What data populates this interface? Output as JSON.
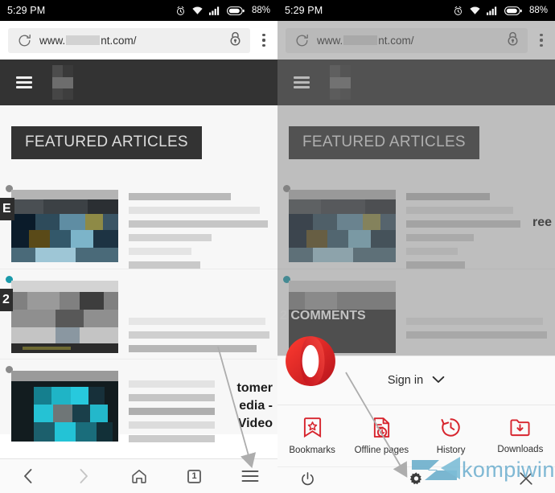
{
  "status_bar": {
    "time": "5:29 PM",
    "battery_percent": "88%",
    "icons": [
      "alarm-icon",
      "wifi-icon",
      "signal-icon",
      "battery-icon"
    ]
  },
  "browser": {
    "url_prefix": "www.",
    "url_suffix": "nt.com/",
    "reload_icon": "reload-icon",
    "lock_icon": "lock-icon",
    "overflow_icon": "kebab-menu-icon"
  },
  "site": {
    "menu_icon": "hamburger-icon",
    "logo": "site-logo",
    "featured_heading": "FEATURED ARTICLES",
    "articles": [
      {
        "badge": "E",
        "title_lines": [
          "",
          "",
          ""
        ],
        "bullet_color": "#8a8a8a"
      },
      {
        "badge": "2",
        "title_lines": [
          "",
          "",
          ""
        ],
        "bullet_color": "#1b9aaa"
      },
      {
        "badge": "",
        "title_lines": [
          "tomer",
          "edia -",
          "Video"
        ],
        "bullet_color": "#8a8a8a"
      }
    ],
    "right_overflow_text": "ree",
    "comments_badge": "2 COMMENTS"
  },
  "bottom_nav": {
    "items": [
      {
        "name": "back-button",
        "icon": "chevron-left-icon",
        "enabled": true
      },
      {
        "name": "forward-button",
        "icon": "chevron-right-icon",
        "enabled": false
      },
      {
        "name": "home-button",
        "icon": "home-icon",
        "enabled": true
      },
      {
        "name": "tabs-button",
        "icon": "tab-count-icon",
        "enabled": true
      },
      {
        "name": "menu-button",
        "icon": "hamburger-icon",
        "enabled": true
      }
    ],
    "tab_count": "1"
  },
  "opera_menu": {
    "logo": "opera-logo",
    "sign_in_label": "Sign in",
    "sign_in_chevron": "chevron-down-icon",
    "items": [
      {
        "label": "Bookmarks",
        "icon": "bookmark-star-icon"
      },
      {
        "label": "Offline pages",
        "icon": "offline-page-icon"
      },
      {
        "label": "History",
        "icon": "history-clock-icon"
      },
      {
        "label": "Downloads",
        "icon": "download-folder-icon"
      }
    ],
    "bottom_actions": [
      {
        "name": "exit-button",
        "icon": "power-icon"
      },
      {
        "name": "settings-button",
        "icon": "gear-icon"
      },
      {
        "name": "close-menu-button",
        "icon": "close-x-icon"
      }
    ],
    "accent_color": "#d7252e"
  },
  "annotations": [
    {
      "name": "arrow-to-menu-button",
      "points_to": "bottom-nav-menu-button"
    },
    {
      "name": "arrow-to-settings-button",
      "points_to": "menu-settings-gear"
    }
  ],
  "watermark": {
    "text": "kompiwin",
    "logo": "kompiwin-chevron-logo",
    "color": "#7fb8d4"
  }
}
